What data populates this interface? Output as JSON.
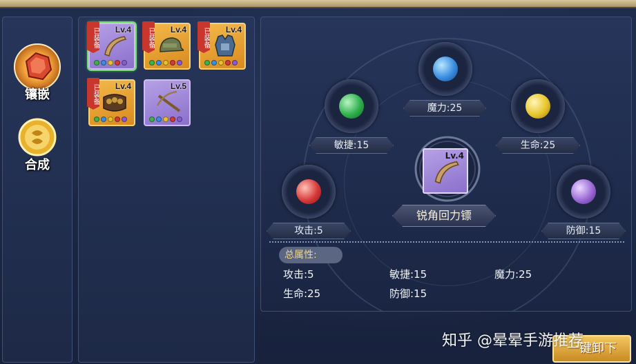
{
  "tabs": [
    {
      "label": "镶嵌",
      "icon": "red-gem-icon"
    },
    {
      "label": "合成",
      "icon": "gold-coin-icon"
    }
  ],
  "items": [
    {
      "level": "Lv.4",
      "equipped_tag": "已装备",
      "icon": "boomerang-icon",
      "rarity": "purple",
      "selected": true,
      "gems": [
        "#3bb34a",
        "#3a8de0",
        "#e6c12b",
        "#d23a3a",
        "#8a5ad0"
      ]
    },
    {
      "level": "Lv.4",
      "equipped_tag": "已装备",
      "icon": "cap-icon",
      "rarity": "gold",
      "selected": false,
      "gems": [
        "#3bb34a",
        "#3a8de0",
        "#e6c12b",
        "#d23a3a",
        "#8a5ad0"
      ]
    },
    {
      "level": "Lv.4",
      "equipped_tag": "已装备",
      "icon": "armor-vest-icon",
      "rarity": "gold",
      "selected": false,
      "gems": [
        "#3bb34a",
        "#3a8de0",
        "#e6c12b",
        "#d23a3a",
        "#8a5ad0"
      ]
    },
    {
      "level": "Lv.4",
      "equipped_tag": "已装备",
      "icon": "bullet-belt-icon",
      "rarity": "gold",
      "selected": false,
      "gems": [
        "#3bb34a",
        "#3a8de0",
        "#e6c12b",
        "#d23a3a",
        "#8a5ad0"
      ]
    },
    {
      "level": "Lv.5",
      "equipped_tag": "",
      "icon": "crossbow-icon",
      "rarity": "purple",
      "selected": false,
      "gems": [
        "#3bb34a",
        "#3a8de0",
        "#e6c12b",
        "#d23a3a",
        "#8a5ad0"
      ]
    }
  ],
  "slots": {
    "magic": {
      "label": "魔力:25",
      "color": "#3a8de0"
    },
    "agility": {
      "label": "敏捷:15",
      "color": "#2fb04c"
    },
    "life": {
      "label": "生命:25",
      "color": "#e8c52b"
    },
    "attack": {
      "label": "攻击:5",
      "color": "#d83a3a"
    },
    "defense": {
      "label": "防御:15",
      "color": "#9a6ad6"
    }
  },
  "selected_item": {
    "level": "Lv.4",
    "name": "锐角回力镖"
  },
  "totals": {
    "title": "总属性:",
    "attack": "攻击:5",
    "agility": "敏捷:15",
    "magic": "魔力:25",
    "life": "生命:25",
    "defense": "防御:15"
  },
  "buttons": {
    "unload_all": "一键卸下"
  },
  "watermark": "知乎 @晕晕手游推荐"
}
